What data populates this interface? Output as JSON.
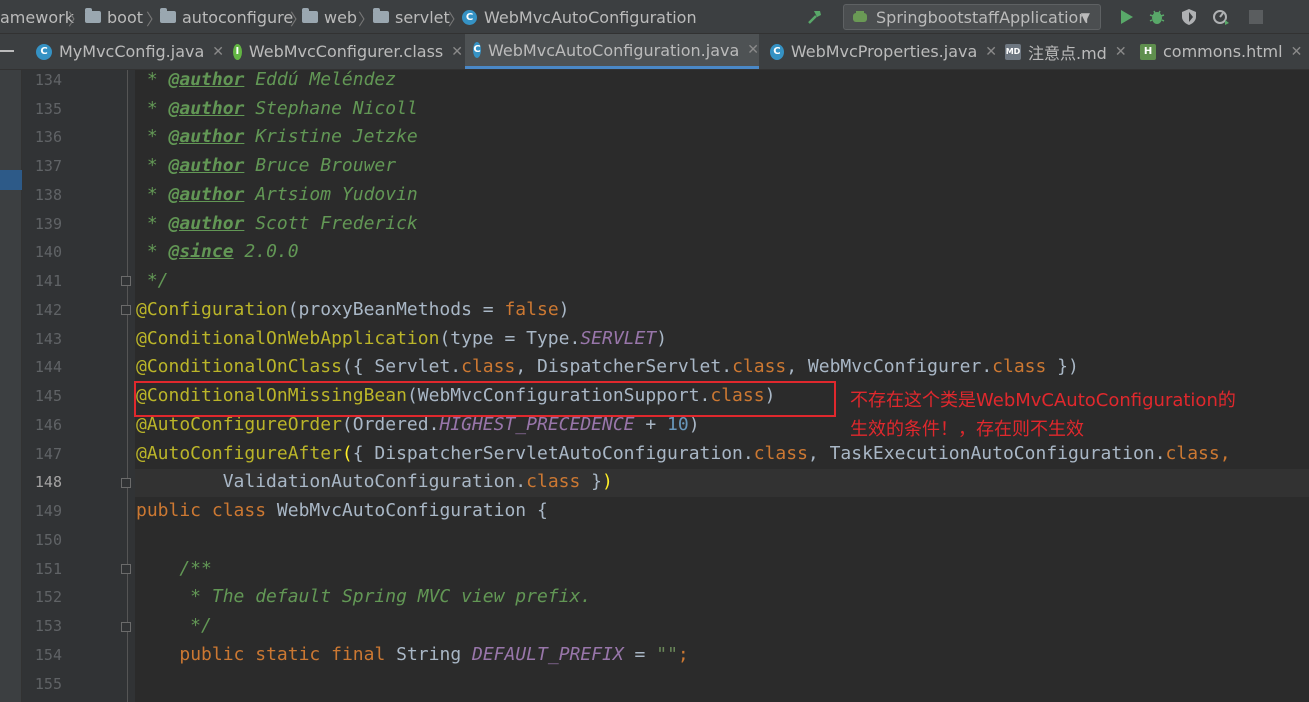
{
  "breadcrumb": {
    "items": [
      "amework",
      "boot",
      "autoconfigure",
      "web",
      "servlet"
    ],
    "current": "WebMvcAutoConfiguration"
  },
  "toolbar": {
    "run_config": "SpringbootstaffApplication"
  },
  "tabs": [
    {
      "label": "MyMvcConfig.java",
      "icon": "class-icon",
      "active": false
    },
    {
      "label": "WebMvcConfigurer.class",
      "icon": "interface-icon",
      "active": false
    },
    {
      "label": "WebMvcAutoConfiguration.java",
      "icon": "class-icon",
      "active": true
    },
    {
      "label": "WebMvcProperties.java",
      "icon": "class-icon",
      "active": false
    },
    {
      "label": "注意点.md",
      "icon": "markdown-icon",
      "active": false
    },
    {
      "label": "commons.html",
      "icon": "html-icon",
      "active": false
    }
  ],
  "editor": {
    "line_numbers": [
      "134",
      "135",
      "136",
      "137",
      "138",
      "139",
      "140",
      "141",
      "142",
      "143",
      "144",
      "145",
      "146",
      "147",
      "148",
      "149",
      "150",
      "151",
      "152",
      "153",
      "154",
      "155"
    ],
    "current_line": "148",
    "code": {
      "authors": [
        "Eddú Meléndez",
        "Stephane Nicoll",
        "Kristine Jetzke",
        "Bruce Brouwer",
        "Artsiom Yudovin",
        "Scott Frederick"
      ],
      "author_tag": "@author",
      "since_tag": "@since",
      "since_version": "2.0.0",
      "l141": " */",
      "l142_ann": "@Configuration",
      "l142_rest": "(proxyBeanMethods = ",
      "l142_false": "false",
      "l142_end": ")",
      "l143_ann": "@ConditionalOnWebApplication",
      "l143_rest": "(type = Type.",
      "l143_const": "SERVLET",
      "l143_end": ")",
      "l144_ann": "@ConditionalOnClass",
      "l144_a": "({ Servlet.",
      "l144_b": ", DispatcherServlet.",
      "l144_c": ", WebMvcConfigurer.",
      "l144_end": " })",
      "l145_ann": "@ConditionalOnMissingBean",
      "l145_rest": "(WebMvcConfigurationSupport.",
      "l145_end": ")",
      "l146_ann": "@AutoConfigureOrder",
      "l146_rest": "(Ordered.",
      "l146_const": "HIGHEST_PRECEDENCE",
      "l146_plus": " + ",
      "l146_num": "10",
      "l146_end": ")",
      "l147_ann": "@AutoConfigureAfter",
      "l147_paren": "(",
      "l147_a": "{ DispatcherServletAutoConfiguration.",
      "l147_b": ", TaskExecutionAutoConfiguration.",
      "l147_comma": ",",
      "l148_a": "        ValidationAutoConfiguration.",
      "l148_b": " }",
      "l148_paren": ")",
      "kw_class": "class",
      "kw_public": "public",
      "l149_name": " WebMvcAutoConfiguration {",
      "l151": "    /**",
      "l152": "     * The default Spring MVC view prefix.",
      "l153": "     */",
      "kw_static": "static",
      "kw_final": "final",
      "l154_type": " String ",
      "l154_const": "DEFAULT_PREFIX",
      "l154_eq": " = ",
      "l154_str": "\"\"",
      "l154_end": ";"
    }
  },
  "annotation_note": {
    "line1": "不存在这个类是WebMvCAutoConfiguration的",
    "line2": "生效的条件！，存在则不生效"
  },
  "colors": {
    "annotation_red": "#e0282d",
    "tab_underline": "#4a88c7"
  }
}
